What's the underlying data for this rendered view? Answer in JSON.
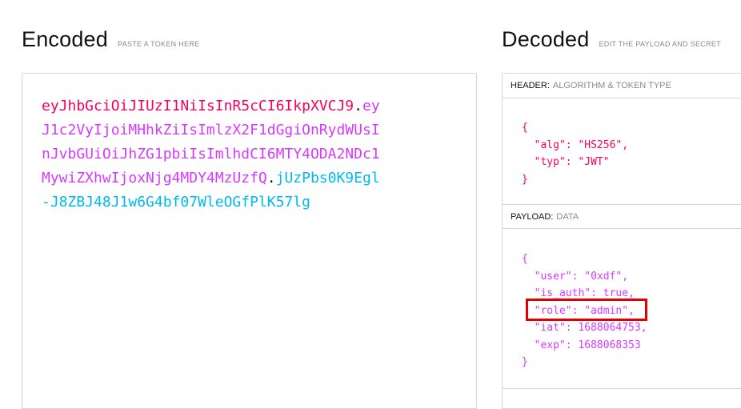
{
  "encoded": {
    "title": "Encoded",
    "subtitle": "PASTE A TOKEN HERE",
    "token_lines": [
      {
        "parts": [
          {
            "text": "eyJhbGciOiJIUzI1NiIsInR5cCI6IkpXVCJ9",
            "kind": "header"
          },
          {
            "text": ".",
            "kind": "dot"
          },
          {
            "text": "ey",
            "kind": "payload"
          }
        ]
      },
      {
        "parts": [
          {
            "text": "J1c2VyIjoiMHhkZiIsImlzX2F1dGgiOnRydWUsI",
            "kind": "payload"
          }
        ]
      },
      {
        "parts": [
          {
            "text": "nJvbGUiOiJhZG1pbiIsImlhdCI6MTY4ODA2NDc1",
            "kind": "payload"
          }
        ]
      },
      {
        "parts": [
          {
            "text": "MywiZXhwIjoxNjg4MDY4MzUzfQ",
            "kind": "payload"
          },
          {
            "text": ".",
            "kind": "dot"
          },
          {
            "text": "jUzPbs0K9Egl",
            "kind": "signature"
          }
        ]
      },
      {
        "parts": [
          {
            "text": "-J8ZBJ48J1w6G4bf07WleOGfPlK57lg",
            "kind": "signature"
          }
        ]
      }
    ]
  },
  "decoded": {
    "title": "Decoded",
    "subtitle": "EDIT THE PAYLOAD AND SECRET",
    "header_panel": {
      "label": "HEADER:",
      "sublabel": "ALGORITHM & TOKEN TYPE",
      "lines": [
        "{",
        "  \"alg\": \"HS256\",",
        "  \"typ\": \"JWT\"",
        "}"
      ]
    },
    "payload_panel": {
      "label": "PAYLOAD:",
      "sublabel": "DATA",
      "lines": [
        "{",
        "  \"user\": \"0xdf\",",
        "  \"is_auth\": true,",
        "  \"role\": \"admin\",",
        "  \"iat\": 1688064753,",
        "  \"exp\": 1688068353",
        "}"
      ]
    }
  },
  "colors": {
    "header": "#fb015b",
    "payload": "#d63aff",
    "signature": "#00b9f1",
    "highlight_box": "#e00000"
  }
}
